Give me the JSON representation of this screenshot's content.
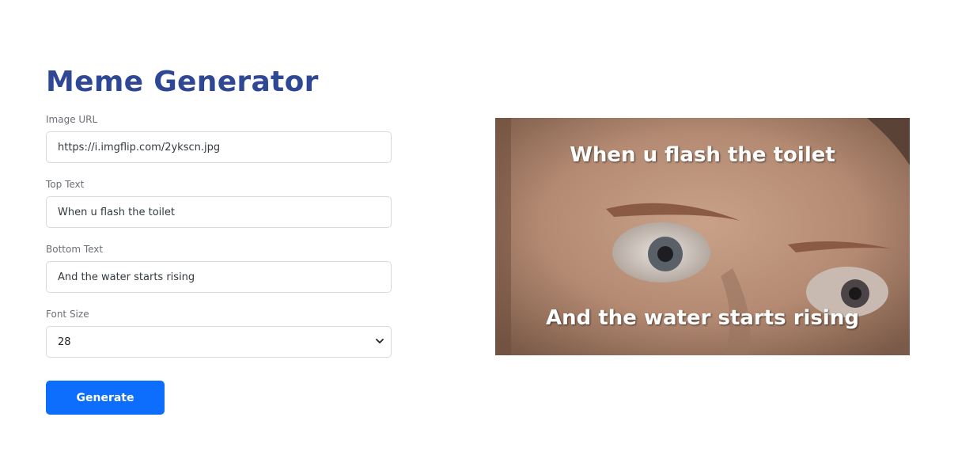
{
  "page": {
    "title": "Meme Generator"
  },
  "form": {
    "image_url": {
      "label": "Image URL",
      "value": "https://i.imgflip.com/2ykscn.jpg"
    },
    "top_text": {
      "label": "Top Text",
      "value": "When u flash the toilet"
    },
    "bottom_text": {
      "label": "Bottom Text",
      "value": "And the water starts rising"
    },
    "font_size": {
      "label": "Font Size",
      "selected": "28"
    },
    "generate_label": "Generate"
  },
  "meme": {
    "top_text": "When u flash the toilet",
    "bottom_text": "And the water starts rising"
  },
  "colors": {
    "title": "#2f4896",
    "button": "#0d6efd",
    "input_border": "#d6dae0"
  },
  "icons": {
    "select_arrow": "chevron-down-icon"
  }
}
